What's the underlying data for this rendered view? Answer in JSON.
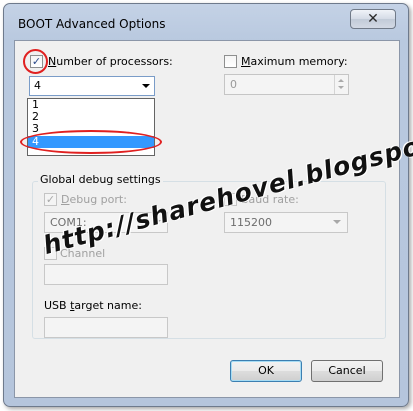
{
  "window": {
    "title": "BOOT Advanced Options",
    "close_symbol": "✕"
  },
  "processors": {
    "checkbox_checked": true,
    "check_glyph": "✓",
    "label_underlined": "N",
    "label_rest": "umber of processors:",
    "selected_value": "4",
    "options": [
      "1",
      "2",
      "3",
      "4"
    ],
    "highlighted_option": "4"
  },
  "memory": {
    "checkbox_checked": false,
    "label_underlined": "M",
    "label_rest": "aximum memory:",
    "value": "0"
  },
  "debug": {
    "group_title": "Global debug settings",
    "debug_port_checked": true,
    "debug_port_check_glyph": "✓",
    "debug_port_underlined": "D",
    "debug_port_rest": "ebug port:",
    "debug_port_value": "COM1:",
    "baud_rate_label": "Baud rate:",
    "baud_rate_value": "115200",
    "channel_checked": false,
    "channel_label": "Channel",
    "channel_value": "",
    "usb_label_pre": "USB ",
    "usb_label_underlined": "t",
    "usb_label_rest": "arget name:",
    "usb_value": ""
  },
  "buttons": {
    "ok": "OK",
    "cancel": "Cancel"
  },
  "watermark": "http://sharehovel.blogspot.com",
  "colors": {
    "highlight": "#3399ff",
    "annotation_ring": "#e02020"
  }
}
